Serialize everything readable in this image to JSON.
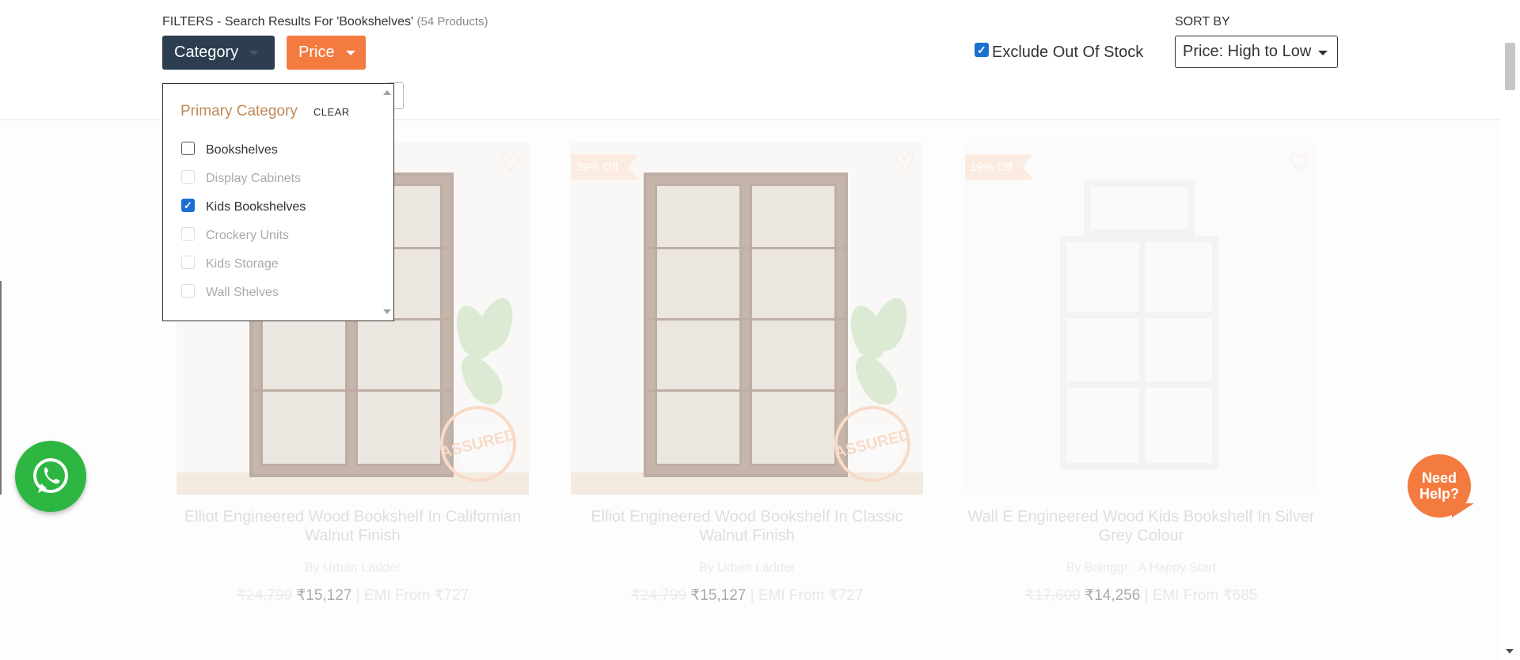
{
  "filters": {
    "title": "FILTERS - Search Results For 'Bookshelves'",
    "count": "(54 Products)",
    "category_label": "Category",
    "price_label": "Price"
  },
  "stock": {
    "exclude_label": "Exclude Out Of Stock",
    "checked": true
  },
  "sort": {
    "label": "SORT BY",
    "selected": "Price: High to Low"
  },
  "category_dropdown": {
    "title": "Primary Category",
    "clear_label": "CLEAR",
    "items": [
      {
        "label": "Bookshelves",
        "state": "unchecked"
      },
      {
        "label": "Display Cabinets",
        "state": "disabled"
      },
      {
        "label": "Kids Bookshelves",
        "state": "checked"
      },
      {
        "label": "Crockery Units",
        "state": "disabled"
      },
      {
        "label": "Kids Storage",
        "state": "disabled"
      },
      {
        "label": "Wall Shelves",
        "state": "disabled"
      }
    ]
  },
  "products": [
    {
      "title": "Elliot Engineered Wood Bookshelf In Californian Walnut Finish",
      "brand": "By Urban Ladder",
      "old_price": "₹24,799",
      "price": "₹15,127",
      "emi": "| EMI From ₹727",
      "badge": "",
      "stamp": "ASSURED"
    },
    {
      "title": "Elliot Engineered Wood Bookshelf In Classic Walnut Finish",
      "brand": "By Urban Ladder",
      "old_price": "₹24,799",
      "price": "₹15,127",
      "emi": "| EMI From ₹727",
      "badge": "39% Off",
      "stamp": "ASSURED"
    },
    {
      "title": "Wall E Engineered Wood Kids Bookshelf In Silver Grey Colour",
      "brand": "By Boingg! - A Happy Start",
      "old_price": "₹17,600",
      "price": "₹14,256",
      "emi": "| EMI From ₹685",
      "badge": "19% Off",
      "stamp": ""
    }
  ],
  "help": {
    "label_line1": "Need",
    "label_line2": "Help?"
  },
  "colors": {
    "accent": "#f47b40",
    "dark": "#2c3e50",
    "checkbox": "#1a6fd1",
    "whatsapp": "#2db742"
  }
}
